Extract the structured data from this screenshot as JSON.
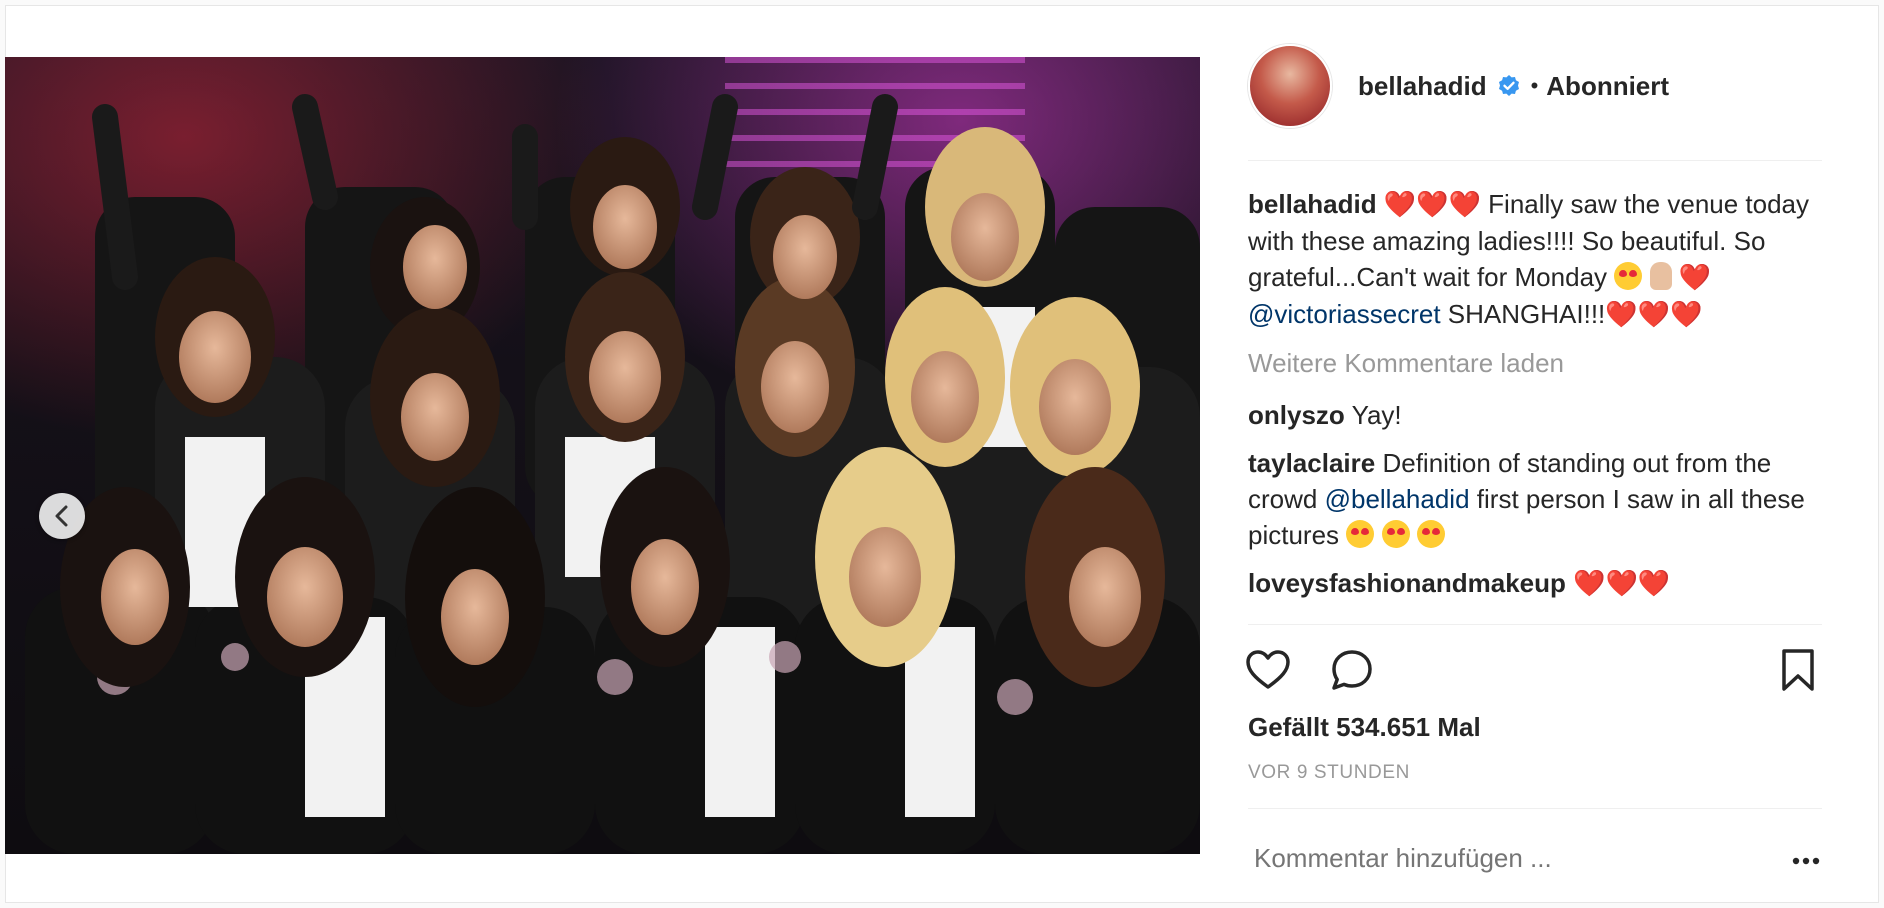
{
  "post": {
    "username": "bellahadid",
    "verified_icon": "verified-badge-icon",
    "separator": "•",
    "follow_status": "Abonniert",
    "caption_user": "bellahadid",
    "caption_text_1": "Finally saw the venue today with these amazing ladies!!!! So beautiful. So grateful...Can't wait for Monday",
    "caption_mention": "@victoriassecret",
    "caption_text_2": "SHANGHAI!!!",
    "load_more": "Weitere Kommentare laden",
    "comments": [
      {
        "user": "onlyszo",
        "text": "Yay!"
      },
      {
        "user": "taylaclaire",
        "text_before": "Definition of standing out from the crowd",
        "mention": "@bellahadid",
        "text_after": "first person I saw in all these pictures"
      },
      {
        "user": "loveysfashionandmakeup",
        "text": ""
      }
    ],
    "likes": "Gefällt 534.651 Mal",
    "timestamp": "VOR 9 STUNDEN",
    "comment_placeholder": "Kommentar hinzufügen ...",
    "carousel": {
      "count": 2,
      "active": 2
    },
    "colors": {
      "mention": "#003569",
      "heart": "#e0162b",
      "verified": "#3897f0",
      "muted": "#999999"
    }
  }
}
